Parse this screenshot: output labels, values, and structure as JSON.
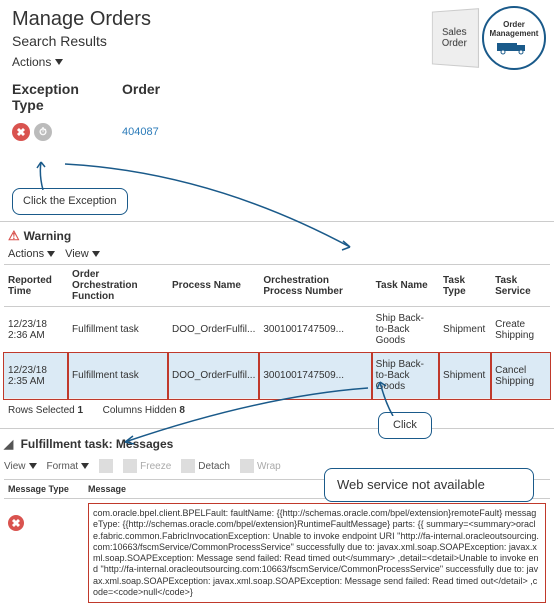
{
  "page": {
    "title": "Manage Orders",
    "subtitle": "Search Results"
  },
  "actions_label": "Actions",
  "corner": {
    "sales_order": "Sales Order",
    "om": "Order Management"
  },
  "columns": {
    "exc_type": "Exception Type",
    "order": "Order"
  },
  "row1": {
    "order_link": "404087"
  },
  "callouts": {
    "click_exc": "Click the Exception",
    "click": "Click",
    "ws": "Web service not available"
  },
  "warning": {
    "title": "Warning",
    "actions": "Actions",
    "view": "View",
    "headers": {
      "reported": "Reported Time",
      "func": "Order Orchestration Function",
      "pname": "Process Name",
      "pnum": "Orchestration Process Number",
      "task": "Task Name",
      "ttype": "Task Type",
      "tservice": "Task Service"
    },
    "rows": [
      {
        "reported": "12/23/18 2:36 AM",
        "func": "Fulfillment task",
        "pname": "DOO_OrderFulfil...",
        "pnum": "3001001747509...",
        "task": "Ship Back-to-Back Goods",
        "ttype": "Shipment",
        "tservice": "Create Shipping"
      },
      {
        "reported": "12/23/18 2:35 AM",
        "func": "Fulfillment task",
        "pname": "DOO_OrderFulfil...",
        "pnum": "3001001747509...",
        "task": "Ship Back-to-Back Goods",
        "ttype": "Shipment",
        "tservice": "Cancel Shipping"
      }
    ],
    "rows_selected_label": "Rows Selected",
    "rows_selected_val": "1",
    "cols_hidden_label": "Columns Hidden",
    "cols_hidden_val": "8"
  },
  "messages": {
    "heading": "Fulfillment task: Messages",
    "view": "View",
    "format": "Format",
    "freeze": "Freeze",
    "detach": "Detach",
    "wrap": "Wrap",
    "col_type": "Message Type",
    "col_msg": "Message",
    "text": "com.oracle.bpel.client.BPELFault: faultName: {{http://schemas.oracle.com/bpel/extension}remoteFault} messageType: {{http://schemas.oracle.com/bpel/extension}RuntimeFaultMessage} parts: {{ summary=<summary>oracle.fabric.common.FabricInvocationException: Unable to invoke endpoint URI \"http://fa-internal.oracleoutsourcing.com:10663/fscmService/CommonProcessService\" successfully due to: javax.xml.soap.SOAPException: javax.xml.soap.SOAPException: Message send failed: Read timed out</summary> ,detail=<detail>Unable to invoke end \"http://fa-internal.oracleoutsourcing.com:10663/fscmService/CommonProcessService\" successfully due to: javax.xml.soap.SOAPException: javax.xml.soap.SOAPException: Message send failed: Read timed out</detail> ,code=<code>null</code>}"
  }
}
